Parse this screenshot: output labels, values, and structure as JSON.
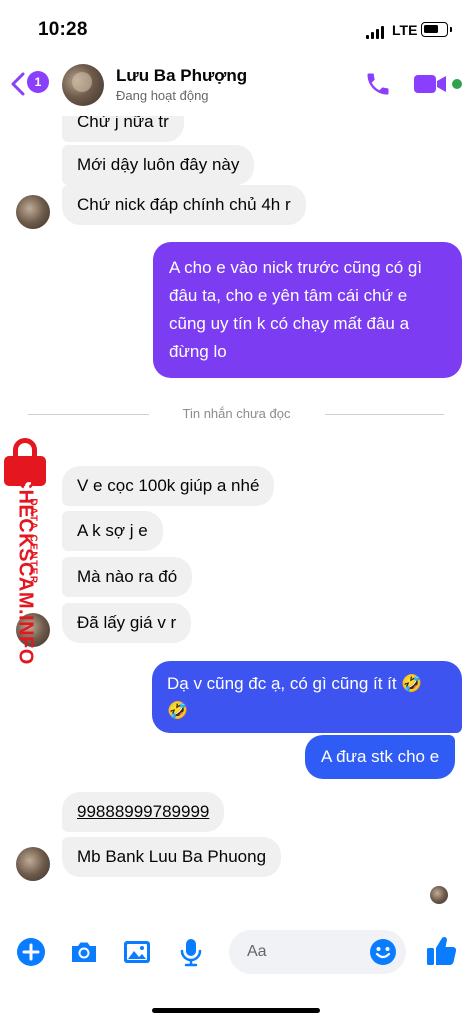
{
  "status_bar": {
    "time": "10:28",
    "network": "LTE"
  },
  "header": {
    "back_badge": "1",
    "contact_name": "Lưu Ba Phượng",
    "status": "Đang hoạt động"
  },
  "messages": {
    "m1": "Chứ j nữa tr",
    "m2": "Mới dậy luôn đây này",
    "m3": "Chứ nick đáp chính chủ 4h r",
    "m4": "A cho e vào nick trước cũng có gì đâu ta, cho e yên tâm cái chứ e cũng uy tín k có chạy mất đâu a đừng lo",
    "m4_lines": [
      "A cho e vào nick trước cũng có gì",
      "đâu ta, cho e yên tâm cái chứ e",
      "cũng uy tín k có chạy mất đâu a",
      "đừng lo"
    ],
    "unread_divider": "Tin nhắn chưa đọc",
    "m5": "V e cọc 100k giúp a nhé",
    "m6": "A k sợ j e",
    "m7": "Mà nào ra đó",
    "m8": "Đã lấy giá v r",
    "m9_line1": "Dạ v cũng đc ạ, có gì cũng ít ít 🤣",
    "m9_line2": "🤣",
    "m10": "A đưa stk cho e",
    "m11": "99888999789999",
    "m12": "Mb Bank Luu Ba Phuong"
  },
  "watermark": {
    "main": "CHECKSCAM.INFO",
    "sub": "DATA CENTER"
  },
  "composer": {
    "placeholder": "Aa"
  },
  "colors": {
    "purple": "#8a3ffc",
    "purple_bubble": "#7b3cf2",
    "blue_bubble": "#3559f2",
    "incoming_bubble": "#f0f0f0",
    "composer_blue": "#0a7cff",
    "watermark_red": "#e4161f"
  },
  "icons": {
    "back": "chevron-left-icon",
    "call": "phone-icon",
    "video": "video-camera-icon",
    "plus": "plus-circle-icon",
    "camera": "camera-icon",
    "gallery": "image-icon",
    "mic": "microphone-icon",
    "emoji": "smiley-icon",
    "like": "thumbs-up-icon"
  }
}
